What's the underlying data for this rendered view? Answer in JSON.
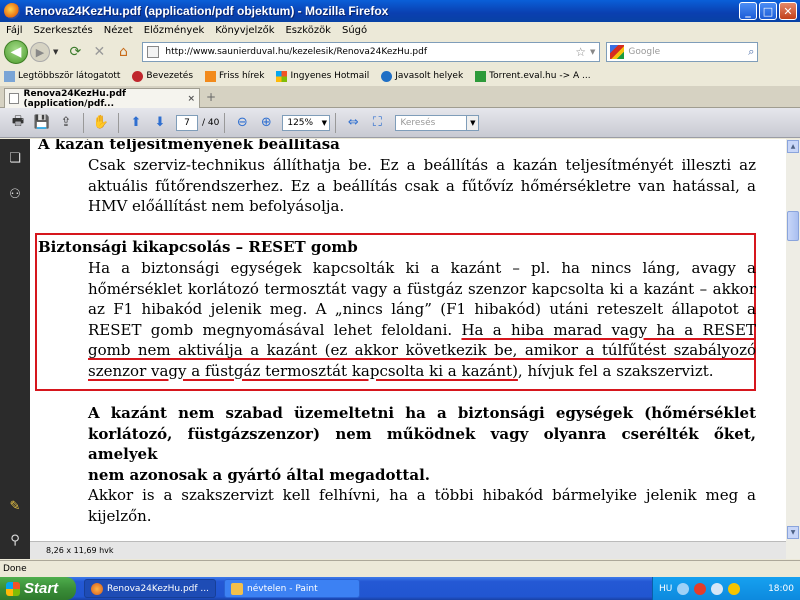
{
  "window": {
    "title": "Renova24KezHu.pdf (application/pdf objektum) - Mozilla Firefox",
    "minimize": "_",
    "maximize": "□",
    "close": "✕"
  },
  "menu": [
    "Fájl",
    "Szerkesztés",
    "Nézet",
    "Előzmények",
    "Könyvjelzők",
    "Eszközök",
    "Súgó"
  ],
  "navbar": {
    "url": "http://www.saunierduval.hu/kezelesik/Renova24KezHu.pdf",
    "search_placeholder": "Google"
  },
  "bookmarks": [
    "Legtöbbször látogatott",
    "Bevezetés",
    "Friss hírek",
    "Ingyenes Hotmail",
    "Javasolt helyek",
    "Torrent.eval.hu -> A ..."
  ],
  "tab": {
    "label": "Renova24KezHu.pdf (application/pdf...",
    "close": "×",
    "new": "+"
  },
  "pdf_toolbar": {
    "page": "7",
    "total": "/ 40",
    "zoom": "125%",
    "search_placeholder": "Keresés"
  },
  "document": {
    "heading1": "A kazán teljesítményének beállítása",
    "para1_lines": [
      "Csak szerviz-technikus állíthatja be. Ez a beállítás a kazán teljesítményét illeszti az",
      "aktuális fűtőrendszerhez. Ez a beállítás csak a fűtővíz hőmérsékletre van hatással, a",
      "HMV előállítást nem befolyásolja."
    ],
    "heading2": "Biztonsági kikapcsolás – RESET gomb",
    "para2_lines": [
      "Ha a biztonsági egységek kapcsolták ki a kazánt – pl. ha nincs láng, avagy a",
      "hőmérséklet korlátozó  termosztát vagy a füstgáz szenzor kapcsolta ki a kazánt – akkor",
      "az F1 hibakód jelenik meg. A „nincs láng” (F1 hibakód) utáni reteszelt állapotot a"
    ],
    "para2_line4_plain": "RESET gomb megnyomásával lehet feloldani. ",
    "para2_line4_underlined": "Ha a hiba marad vagy ha a RESET",
    "para2_line5_underlined": "gomb nem aktiválja a kazánt (ez akkor következik be, amikor a túlfűtést szabályozó",
    "para2_line6_underlined": "szenzor vagy a füstgáz termosztát kapcsolta ki a kazánt)",
    "para2_line6_plain": ", hívjuk fel a szakszervizt.",
    "para3_lines": [
      "A kazánt nem szabad üzemeltetni ha a biztonsági egységek (hőmérséklet",
      "korlátozó, füstgázszenzor) nem működnek vagy olyanra cserélték őket, amelyek",
      "nem azonosak a gyártó által megadottal."
    ],
    "para4_lines": [
      "Akkor is a szakszervizt kell felhívni, ha a többi hibakód bármelyike jelenik meg a",
      "kijelzőn."
    ]
  },
  "pdf_status": "8,26 x 11,69 hvk",
  "status": "Done",
  "taskbar": {
    "start": "Start",
    "items": [
      "Renova24KezHu.pdf ...",
      "névtelen - Paint"
    ],
    "lang": "HU",
    "clock": "18:00"
  },
  "colors": {
    "highlight_red": "#d6161d",
    "title_blue": "#0a3fb0",
    "taskbar_blue": "#2458d4",
    "start_green": "#3a8e38"
  }
}
